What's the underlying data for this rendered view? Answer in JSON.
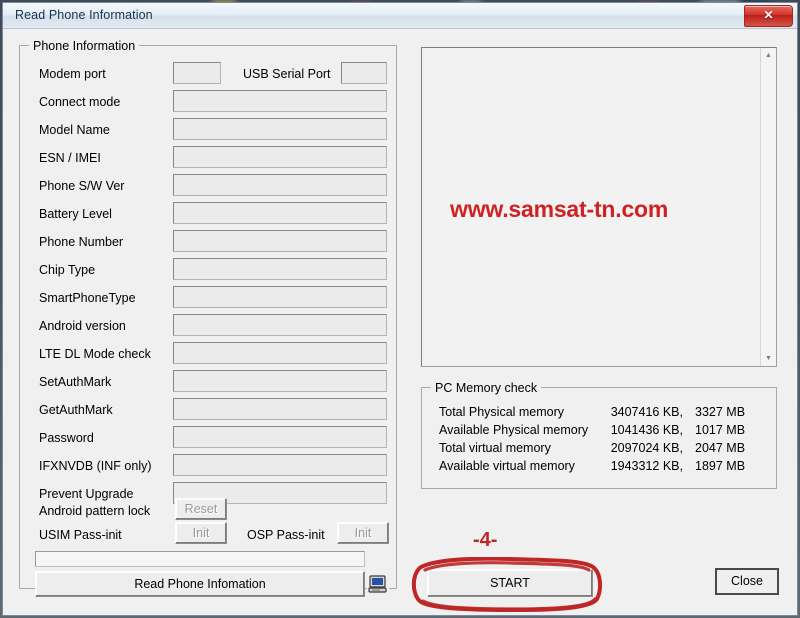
{
  "window": {
    "title": "Read Phone Information",
    "close_glyph": "✕"
  },
  "phone_information": {
    "group_title": "Phone Information",
    "fields": [
      {
        "label": "Modem port",
        "value": ""
      },
      {
        "label": "Connect mode",
        "value": ""
      },
      {
        "label": "Model Name",
        "value": ""
      },
      {
        "label": "ESN / IMEI",
        "value": ""
      },
      {
        "label": "Phone S/W Ver",
        "value": ""
      },
      {
        "label": "Battery Level",
        "value": ""
      },
      {
        "label": "Phone Number",
        "value": ""
      },
      {
        "label": "Chip Type",
        "value": ""
      },
      {
        "label": "SmartPhoneType",
        "value": ""
      },
      {
        "label": "Android version",
        "value": ""
      },
      {
        "label": "LTE DL Mode check",
        "value": ""
      },
      {
        "label": "SetAuthMark",
        "value": ""
      },
      {
        "label": "GetAuthMark",
        "value": ""
      },
      {
        "label": "Password",
        "value": ""
      },
      {
        "label": "IFXNVDB (INF only)",
        "value": ""
      },
      {
        "label": "Prevent Upgrade",
        "value": ""
      }
    ],
    "usb_serial_port_label": "USB Serial Port",
    "usb_serial_port_value": "",
    "android_pattern_lock_label": "Android pattern lock",
    "reset_button": "Reset",
    "usim_pass_init_label": "USIM Pass-init",
    "usim_init_button": "Init",
    "osp_pass_init_label": "OSP Pass-init",
    "osp_init_button": "Init",
    "read_phone_button": "Read Phone Infomation",
    "pc_icon_name": "computer-icon",
    "progress_value": ""
  },
  "log": {
    "content": "",
    "watermark": "www.samsat-tn.com",
    "scroll_up_glyph": "▲",
    "scroll_down_glyph": "▼"
  },
  "pc_memory_check": {
    "group_title": "PC Memory check",
    "rows": [
      {
        "label": "Total Physical memory",
        "kb": "3407416 KB,",
        "mb": "3327 MB"
      },
      {
        "label": "Available Physical memory",
        "kb": "1041436 KB,",
        "mb": "1017 MB"
      },
      {
        "label": "Total virtual memory",
        "kb": "2097024 KB,",
        "mb": "2047 MB"
      },
      {
        "label": "Available virtual memory",
        "kb": "1943312 KB,",
        "mb": "1897 MB"
      }
    ]
  },
  "footer": {
    "start_button": "START",
    "close_button": "Close"
  },
  "annotation": {
    "step_number": "-4-",
    "color": "#c02626"
  }
}
